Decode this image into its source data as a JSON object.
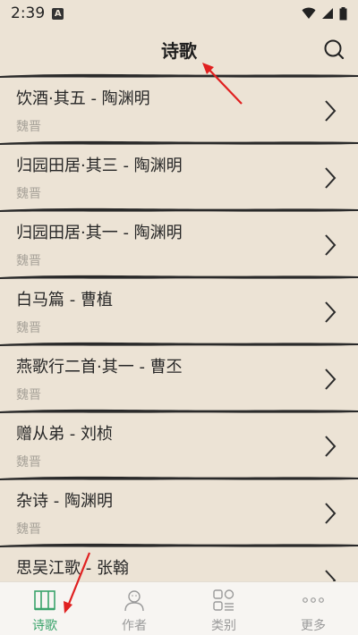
{
  "status_bar": {
    "time": "2:39",
    "badge": "A"
  },
  "header": {
    "title": "诗歌"
  },
  "poems": [
    {
      "title": "饮酒·其五 - 陶渊明",
      "dynasty": "魏晋"
    },
    {
      "title": "归园田居·其三 - 陶渊明",
      "dynasty": "魏晋"
    },
    {
      "title": "归园田居·其一 - 陶渊明",
      "dynasty": "魏晋"
    },
    {
      "title": "白马篇 - 曹植",
      "dynasty": "魏晋"
    },
    {
      "title": "燕歌行二首·其一 - 曹丕",
      "dynasty": "魏晋"
    },
    {
      "title": "赠从弟 - 刘桢",
      "dynasty": "魏晋"
    },
    {
      "title": "杂诗 - 陶渊明",
      "dynasty": "魏晋"
    },
    {
      "title": "思吴江歌 - 张翰",
      "dynasty": ""
    }
  ],
  "tabs": [
    {
      "label": "诗歌",
      "icon": "poem-book-icon",
      "active": true
    },
    {
      "label": "作者",
      "icon": "author-person-icon",
      "active": false
    },
    {
      "label": "类别",
      "icon": "category-grid-icon",
      "active": false
    },
    {
      "label": "更多",
      "icon": "more-dots-icon",
      "active": false
    }
  ],
  "colors": {
    "accent": "#3aa36b",
    "background": "#ece3d5",
    "arrow": "#e02020"
  }
}
